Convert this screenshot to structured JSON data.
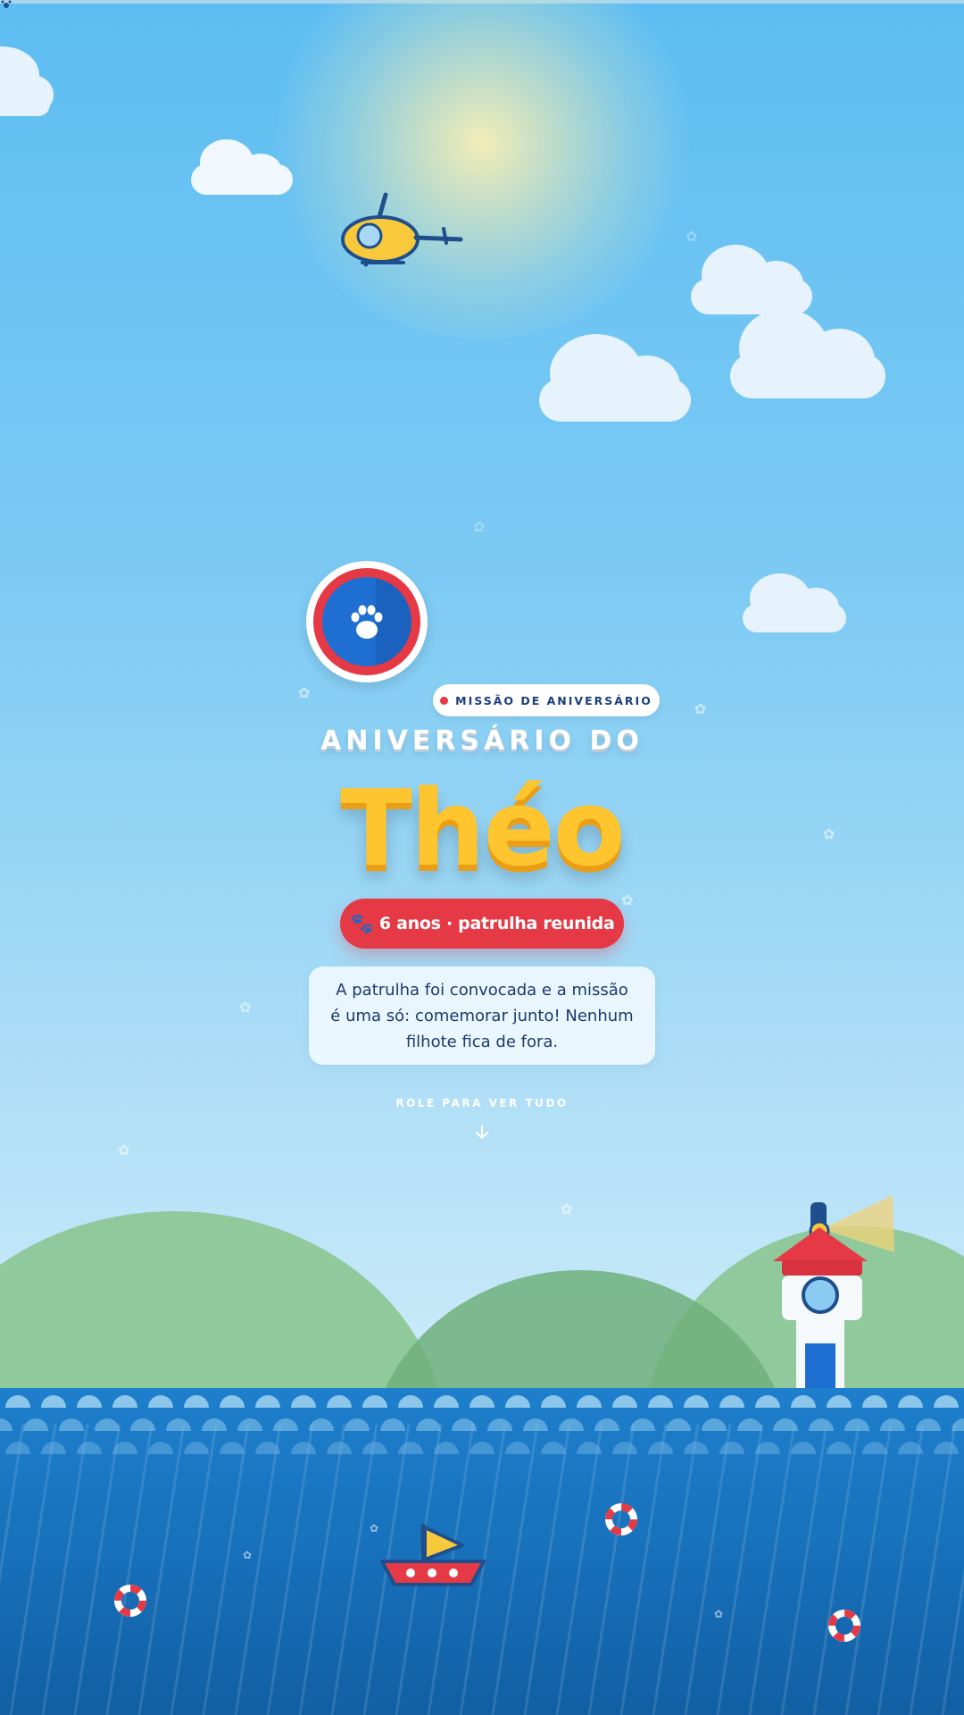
{
  "hero": {
    "tag": "MISSÃO DE ANIVERSÁRIO",
    "heading": "ANIVERSÁRIO DO",
    "name": "Théo",
    "subtitle": "6 anos · patrulha reunida",
    "message": "A patrulha foi convocada e a missão é uma só: comemorar junto! Nenhum filhote fica de fora.",
    "scroll_hint": "ROLE PARA VER TUDO"
  },
  "icons": {
    "badge": "paw-icon",
    "subtitle": "paw-prints-icon",
    "scroll": "arrow-down-icon"
  },
  "colors": {
    "sky": "#5dbdf2",
    "accent_red": "#e63946",
    "name_yellow": "#ffc52e",
    "badge_blue": "#1e6fd1",
    "sea_blue": "#1872bd",
    "hill_green": "#8fc99c"
  }
}
